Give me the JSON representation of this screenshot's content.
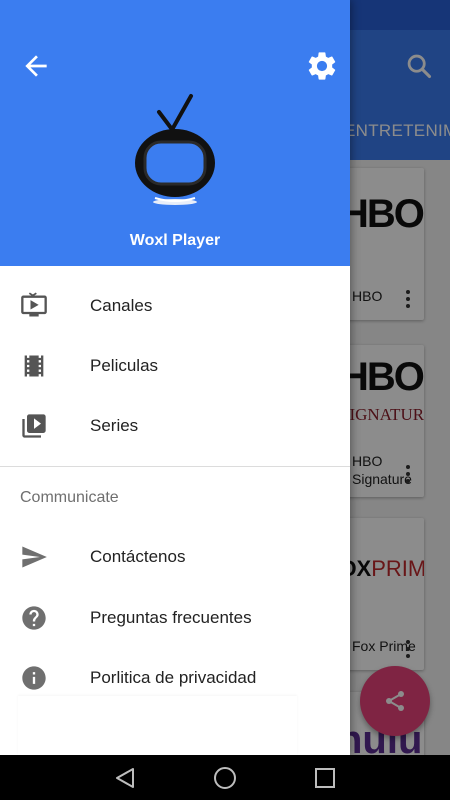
{
  "background": {
    "tab_label": "ENTRETENIMIENTO",
    "cards": [
      {
        "logo_text": "HBO",
        "title": "HBO"
      },
      {
        "logo_text": "HBO",
        "logo_subtext": "SIGNATURE",
        "title_line1": "HBO",
        "title_line2": "Signature"
      },
      {
        "logo_text": "FOX",
        "logo_subtext": "PRIME",
        "title": "Fox Prime"
      },
      {
        "logo_text": "hulu"
      }
    ],
    "fab_icon": "share-icon",
    "search_icon": "search-icon"
  },
  "drawer": {
    "back_icon": "arrow-back-icon",
    "settings_icon": "gear-icon",
    "app_name": "Woxl Player",
    "menu": [
      {
        "label": "Canales",
        "icon": "tv-icon"
      },
      {
        "label": "Peliculas",
        "icon": "film-icon"
      },
      {
        "label": "Series",
        "icon": "video-library-icon"
      }
    ],
    "section_title": "Communicate",
    "communicate": [
      {
        "label": "Contáctenos",
        "icon": "send-icon"
      },
      {
        "label": "Preguntas frecuentes",
        "icon": "help-icon"
      },
      {
        "label": "Porlitica de privacidad",
        "icon": "info-icon"
      }
    ]
  },
  "colors": {
    "primary": "#3b7df0",
    "status_bar": "#2962d9",
    "fab": "#e8427a",
    "icon_grey": "#6f6f6f"
  },
  "navbar": {
    "icons": [
      "back-triangle-icon",
      "home-circle-icon",
      "recents-square-icon"
    ]
  }
}
